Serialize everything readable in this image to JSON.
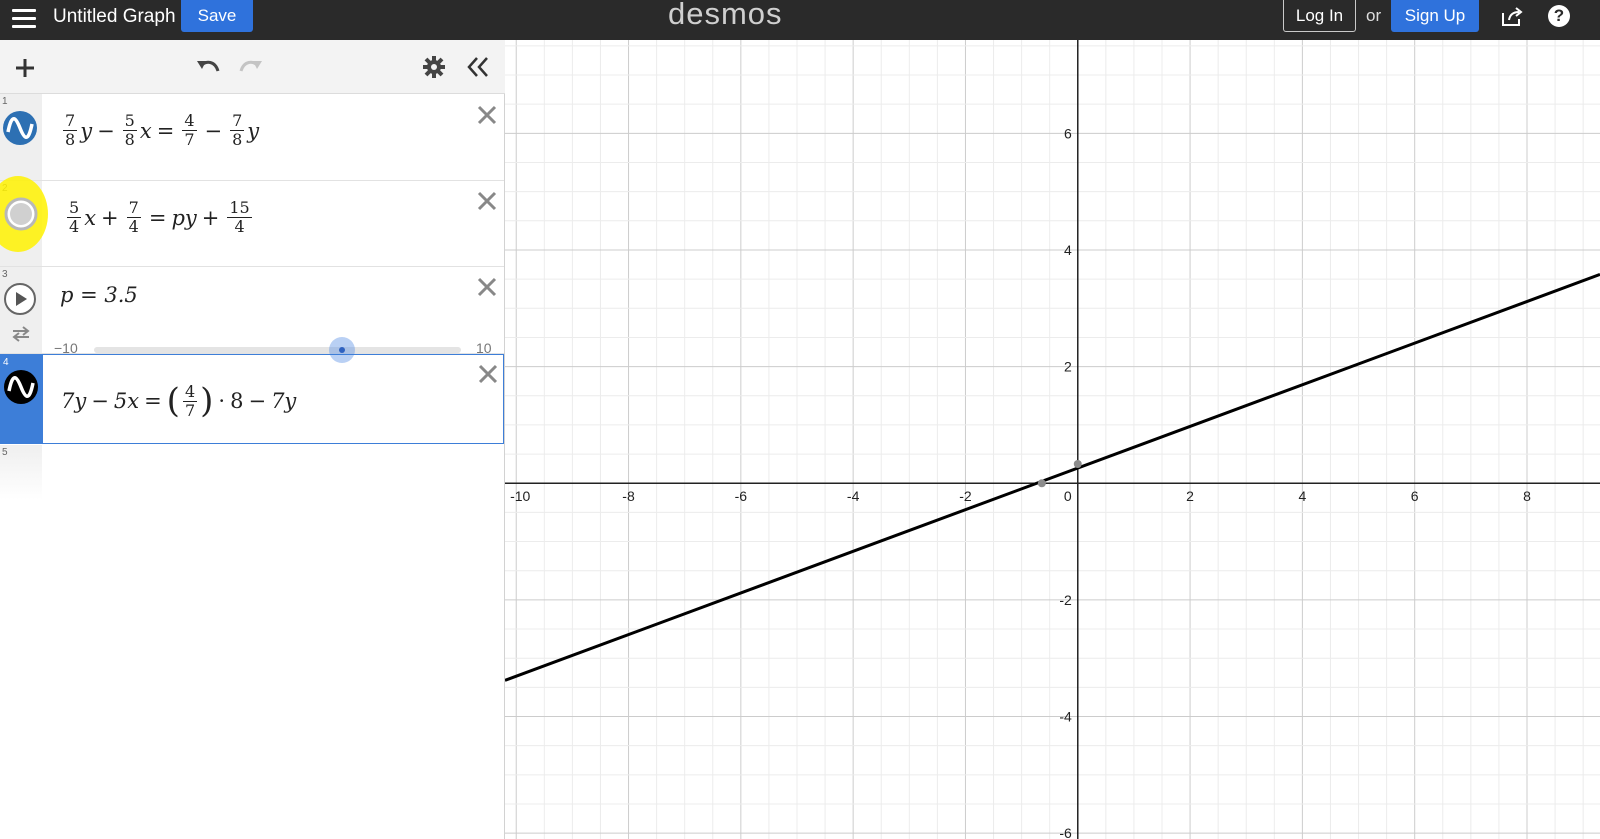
{
  "header": {
    "title": "Untitled Graph",
    "save_label": "Save",
    "logo": "desmos",
    "login_label": "Log In",
    "or_text": "or",
    "signup_label": "Sign Up",
    "help_label": "?"
  },
  "expressions": [
    {
      "index": "1",
      "color": "#2d70b3",
      "latex": "7/8 y - 5/8 x = 4/7 - 7/8 y"
    },
    {
      "index": "2",
      "color": "#9a9a9a",
      "latex": "5/4 x + 7/4 = p y + 15/4",
      "hidden": true
    },
    {
      "index": "3",
      "latex": "p = 3.5",
      "slider": {
        "min_label": "−10",
        "max_label": "10",
        "value": 3.5,
        "min": -10,
        "max": 10
      }
    },
    {
      "index": "4",
      "color": "#000000",
      "latex": "7y - 5x = (4/7)·8 - 7y",
      "selected": true
    },
    {
      "index": "5"
    }
  ],
  "graph": {
    "x_ticks": [
      "-10",
      "-8",
      "-6",
      "-4",
      "-2",
      "0",
      "2",
      "4",
      "6",
      "8"
    ],
    "y_ticks": [
      "6",
      "4",
      "2",
      "-2",
      "-4",
      "-6"
    ]
  },
  "chart_data": {
    "type": "line",
    "xlim": [
      -10.2,
      9.3
    ],
    "ylim": [
      -6.1,
      7.6
    ],
    "grid": true,
    "series": [
      {
        "color": "#000000",
        "x": [
          -10.2,
          9.3
        ],
        "y": [
          -3.38,
          3.58
        ]
      }
    ],
    "points": [
      {
        "x": -0.64,
        "y": 0
      },
      {
        "x": 0,
        "y": 0.33
      }
    ]
  }
}
